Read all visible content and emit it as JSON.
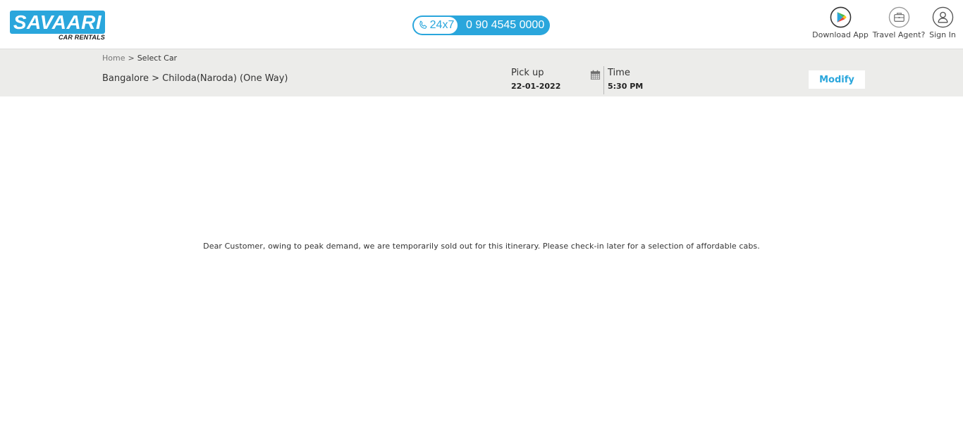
{
  "header": {
    "logo": {
      "name": "SAVAARI",
      "tagline": "CAR RENTALS"
    },
    "phone": {
      "availability": "24x7",
      "number": "0 90 4545 0000"
    },
    "nav": {
      "download_app": "Download App",
      "travel_agent": "Travel Agent?",
      "sign_in": "Sign In"
    }
  },
  "breadcrumb": {
    "home": "Home",
    "separator": ">",
    "current": "Select Car"
  },
  "trip": {
    "route": "Bangalore > Chiloda(Naroda) (One Way)",
    "pickup_label": "Pick up",
    "pickup_date": "22-01-2022",
    "time_label": "Time",
    "time_value": "5:30 PM",
    "modify_label": "Modify"
  },
  "message": "Dear Customer, owing to peak demand, we are temporarily sold out for this itinerary. Please check-in later for a selection of affordable cabs.",
  "icons": {
    "phone": "phone-icon",
    "play_store": "play-store-icon",
    "briefcase": "briefcase-icon",
    "user": "user-icon",
    "calendar": "calendar-icon"
  },
  "colors": {
    "brand_blue": "#2aa6dc",
    "subbar_bg": "#ececea"
  }
}
